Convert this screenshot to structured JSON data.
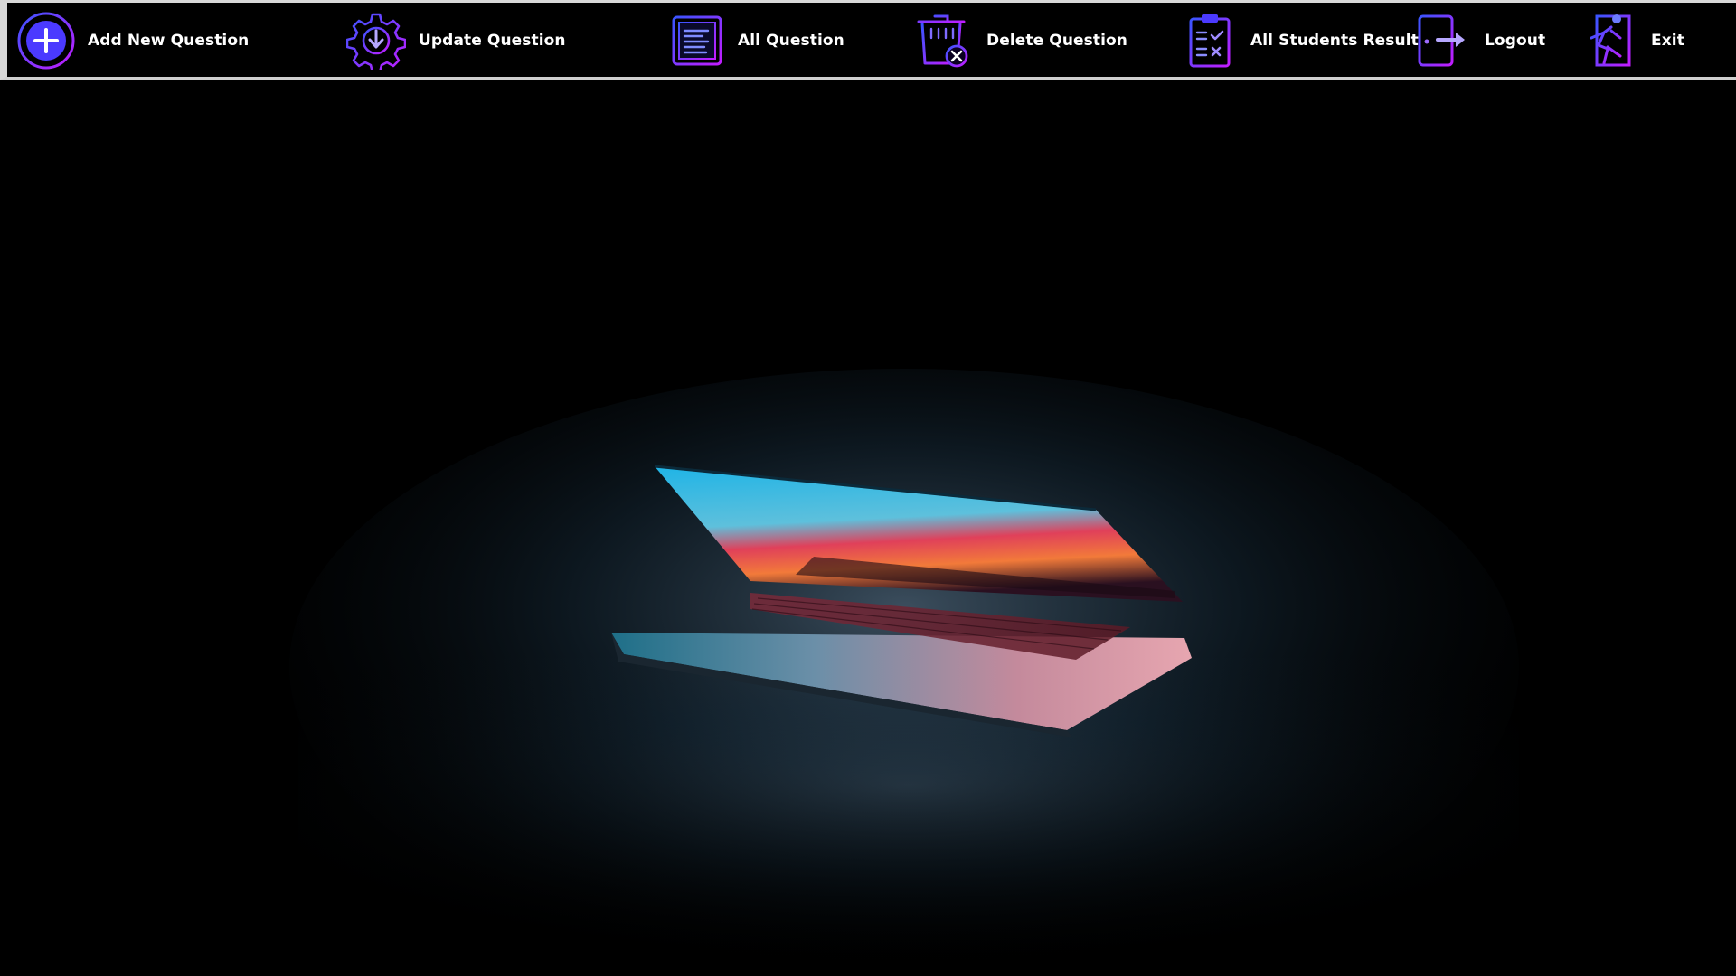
{
  "toolbar": {
    "items": [
      {
        "label": "Add New Question",
        "icon": "add-circle-icon"
      },
      {
        "label": "Update Question",
        "icon": "gear-download-icon"
      },
      {
        "label": "All Question",
        "icon": "document-list-icon"
      },
      {
        "label": "Delete Question",
        "icon": "trash-delete-icon"
      },
      {
        "label": "All Students Result",
        "icon": "clipboard-check-icon"
      },
      {
        "label": "Logout",
        "icon": "door-exit-icon"
      },
      {
        "label": "Exit",
        "icon": "running-exit-icon"
      }
    ]
  },
  "background": {
    "subject": "laptop-image",
    "colors": {
      "icon_gradient_start": "#3a4cff",
      "icon_gradient_end": "#c020ff",
      "toolbar_border": "#d7d7d7"
    }
  }
}
